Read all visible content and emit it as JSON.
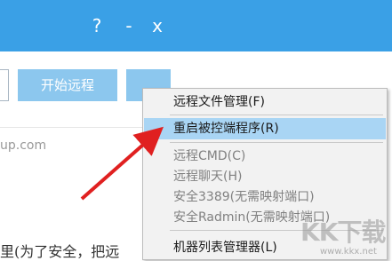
{
  "window": {
    "help_label": "?",
    "minimize_label": "-",
    "close_label": "x"
  },
  "main": {
    "start_button_label": "开始远程",
    "url_fragment": "up.com",
    "bottom_text_fragment": "里(为了安全，把远"
  },
  "context_menu": {
    "items": [
      {
        "label": "远程文件管理(F)",
        "state": "normal"
      },
      {
        "label": "重启被控端程序(R)",
        "state": "selected"
      },
      {
        "label": "远程CMD(C)",
        "state": "disabled"
      },
      {
        "label": "远程聊天(H)",
        "state": "disabled"
      },
      {
        "label": "安全3389(无需映射端口)",
        "state": "disabled"
      },
      {
        "label": "安全Radmin(无需映射端口)",
        "state": "disabled"
      },
      {
        "label": "机器列表管理器(L)",
        "state": "normal"
      }
    ]
  },
  "watermark": {
    "logo_text": "KK下载",
    "url": "www.kkx.net"
  },
  "colors": {
    "titlebar": "#3aa0e6",
    "button": "#8cc7ee",
    "menu_highlight": "#a9d5f4",
    "annotation_arrow": "#e02020"
  }
}
